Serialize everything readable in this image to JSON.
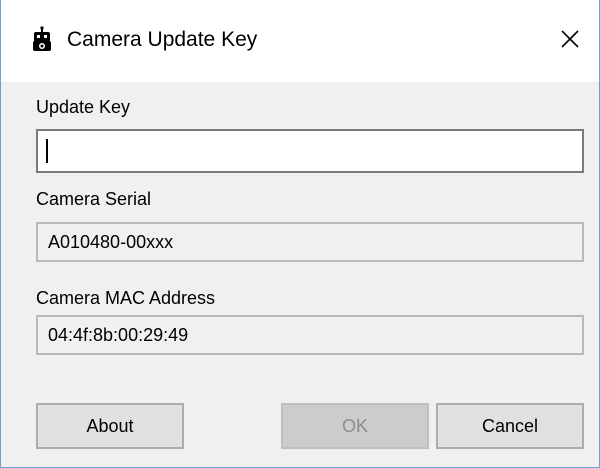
{
  "window": {
    "title": "Camera Update Key",
    "icon": "robot-camera-icon",
    "close_icon": "close-icon"
  },
  "fields": {
    "update_key": {
      "label": "Update Key",
      "value": ""
    },
    "camera_serial": {
      "label": "Camera Serial",
      "value": "A010480-00xxx"
    },
    "camera_mac": {
      "label": "Camera MAC Address",
      "value": "04:4f:8b:00:29:49"
    }
  },
  "buttons": {
    "about": "About",
    "ok": "OK",
    "cancel": "Cancel"
  },
  "colors": {
    "window_border": "#6f9fd3",
    "background": "#f0f0f0",
    "titlebar": "#ffffff",
    "disabled_text": "#8d8d8d"
  }
}
